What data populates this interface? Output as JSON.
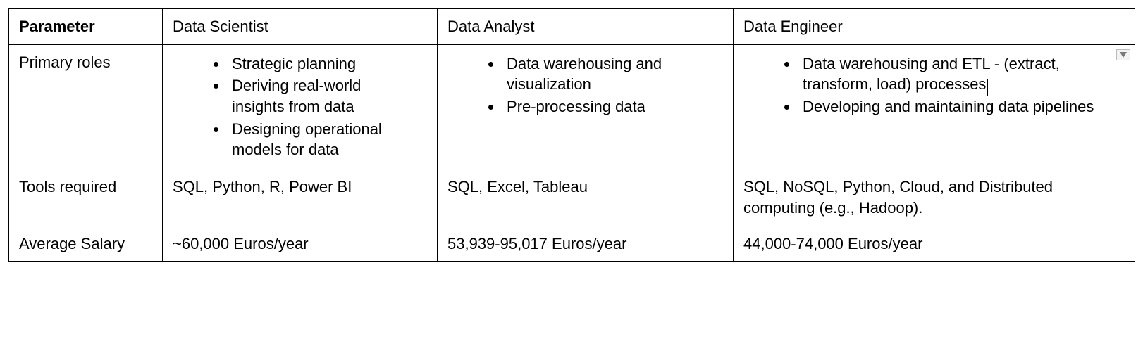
{
  "table": {
    "headers": [
      "Parameter",
      "Data Scientist",
      "Data Analyst",
      "Data Engineer"
    ],
    "rows": [
      {
        "label": "Primary roles",
        "scientist": {
          "bullets": [
            "Strategic planning",
            "Deriving real-world insights from data",
            "Designing operational models for data"
          ]
        },
        "analyst": {
          "bullets": [
            "Data warehousing and visualization",
            "Pre-processing data"
          ]
        },
        "engineer": {
          "bullets": [
            "Data warehousing and ETL - (extract, transform, load) processes",
            "Developing and maintaining data pipelines"
          ],
          "has_cursor": true,
          "has_dropdown": true
        }
      },
      {
        "label": "Tools required",
        "scientist": {
          "text": "SQL, Python, R, Power BI"
        },
        "analyst": {
          "text": "SQL, Excel, Tableau"
        },
        "engineer": {
          "text": "SQL, NoSQL, Python, Cloud, and Distributed computing (e.g., Hadoop)."
        }
      },
      {
        "label": "Average Salary",
        "scientist": {
          "text": "~60,000 Euros/year"
        },
        "analyst": {
          "text": "53,939-95,017 Euros/year"
        },
        "engineer": {
          "text": "44,000-74,000 Euros/year"
        }
      }
    ]
  }
}
